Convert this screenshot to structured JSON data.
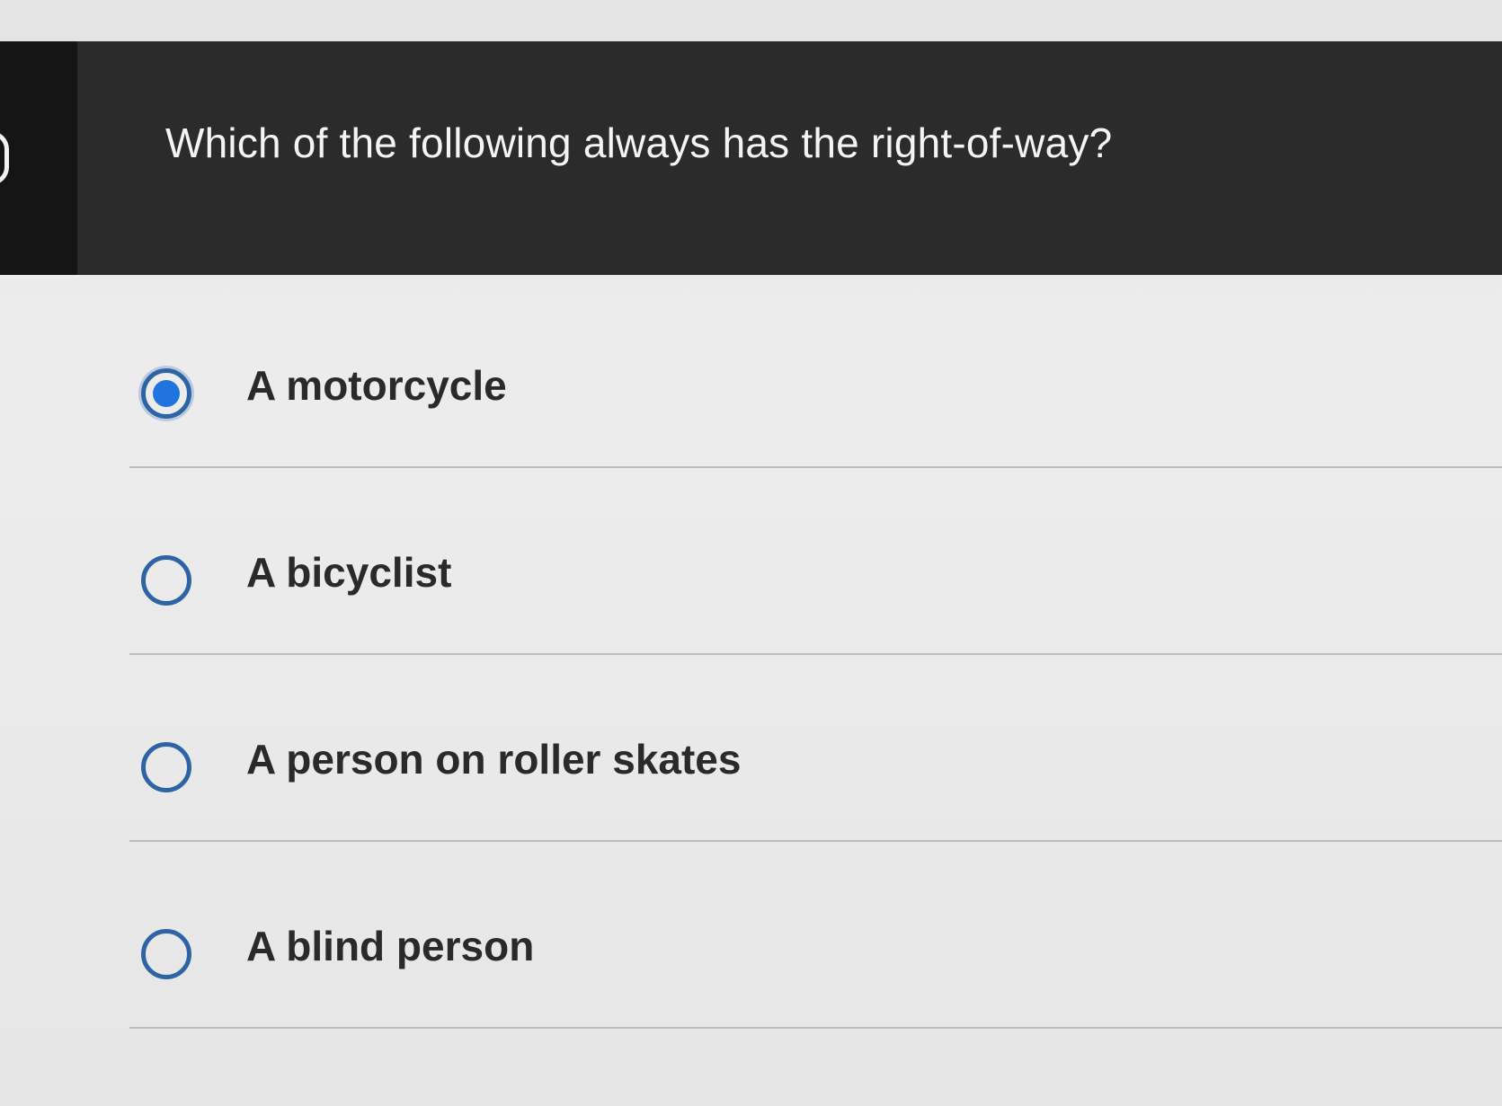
{
  "question": {
    "text": "Which of the following always has the right-of-way?"
  },
  "options": [
    {
      "label": "A motorcycle",
      "selected": true
    },
    {
      "label": "A bicyclist",
      "selected": false
    },
    {
      "label": "A person on roller skates",
      "selected": false
    },
    {
      "label": "A blind person",
      "selected": false
    }
  ],
  "colors": {
    "header_bg": "#2b2b2b",
    "radio_ring": "#2d64a6",
    "radio_fill": "#1f74e0"
  }
}
